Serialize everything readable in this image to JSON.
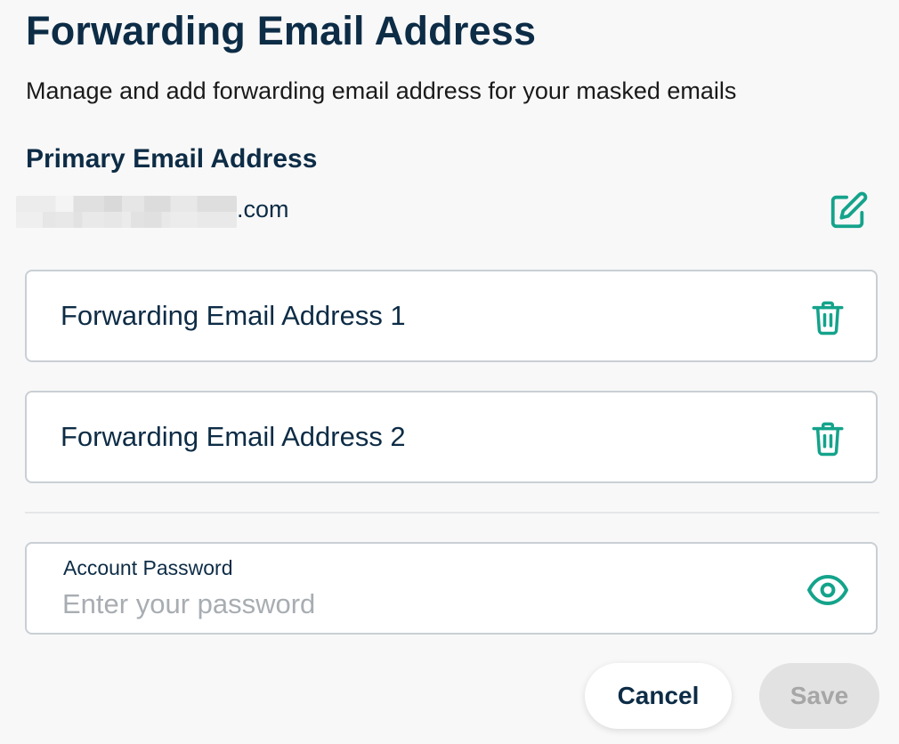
{
  "header": {
    "title": "Forwarding Email Address",
    "subtitle": "Manage and add forwarding email address for your masked emails"
  },
  "primary": {
    "heading": "Primary Email Address",
    "email_domain": ".com",
    "edit_icon": "edit-icon"
  },
  "forwarding": [
    {
      "label": "Forwarding Email Address 1",
      "icon": "trash-icon"
    },
    {
      "label": "Forwarding Email Address 2",
      "icon": "trash-icon"
    }
  ],
  "password": {
    "label": "Account Password",
    "placeholder": "Enter your password",
    "value": "",
    "icon": "eye-icon"
  },
  "actions": {
    "cancel_label": "Cancel",
    "save_label": "Save"
  },
  "colors": {
    "primary_text": "#0d2c46",
    "accent": "#14a38b",
    "border": "#c9cfd4",
    "disabled_bg": "#e2e2e2",
    "disabled_text": "#a6a6a6"
  }
}
